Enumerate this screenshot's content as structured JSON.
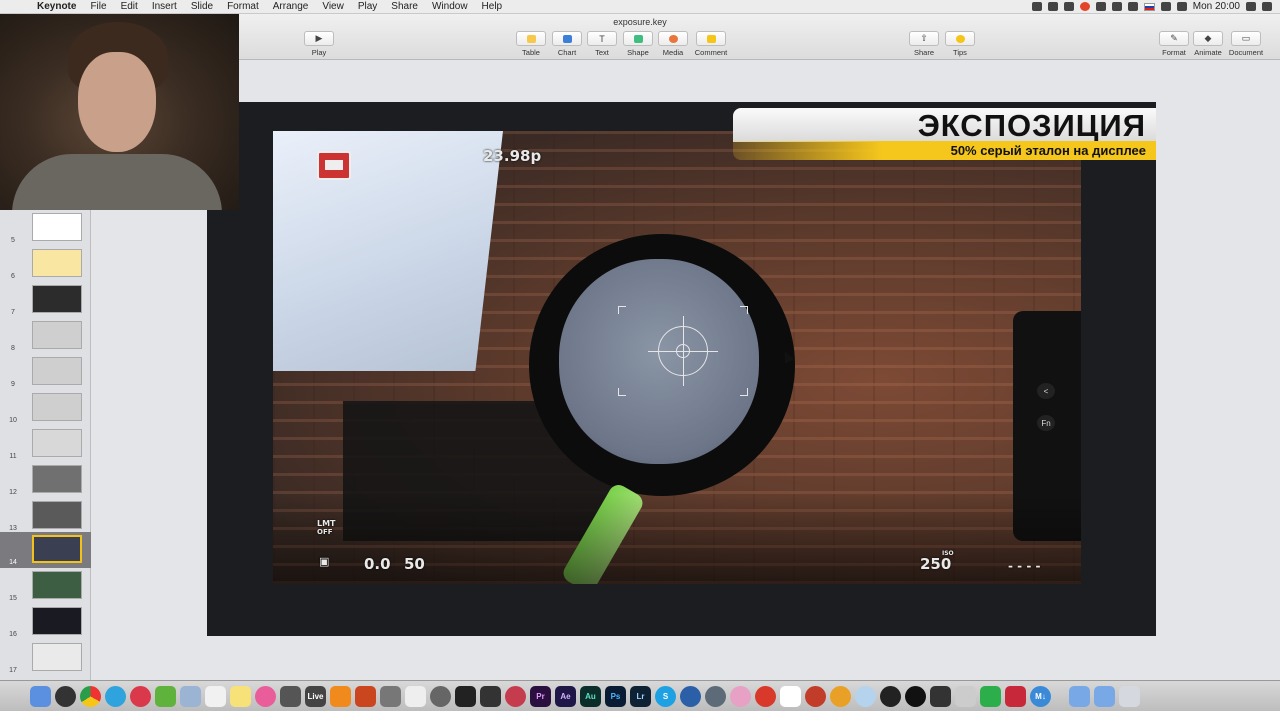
{
  "menubar": {
    "app": "Keynote",
    "items": [
      "File",
      "Edit",
      "Insert",
      "Slide",
      "Format",
      "Arrange",
      "View",
      "Play",
      "Share",
      "Window",
      "Help"
    ],
    "clock": "Mon 20:00"
  },
  "toolbar": {
    "doc_title": "exposure.key",
    "play": "Play",
    "table": "Table",
    "chart": "Chart",
    "text": "Text",
    "shape": "Shape",
    "media": "Media",
    "comment": "Comment",
    "share": "Share",
    "tips": "Tips",
    "format": "Format",
    "animate": "Animate",
    "document": "Document",
    "colors": {
      "table": "#f7c84a",
      "chart": "#3b7fd9",
      "shape": "#3fbf7f",
      "media": "#e8763a",
      "comment": "#f5c518",
      "tips": "#f5c518"
    }
  },
  "sidebar": {
    "slides": [
      "5",
      "6",
      "7",
      "8",
      "9",
      "10",
      "11",
      "12",
      "13",
      "14",
      "15",
      "16",
      "17"
    ],
    "selected": "14"
  },
  "slide": {
    "banner_title": "ЭКСПОЗИЦИЯ",
    "banner_subtitle": "50% серый эталон на дисплее",
    "osd": {
      "fps": "23.98p",
      "lmt": "LMT",
      "off": "OFF",
      "ev": "0.0",
      "fifty": "50",
      "shutter": "250",
      "iso_small": "ISO"
    },
    "camera_buttons": [
      "<",
      "Fn"
    ]
  },
  "dock": {
    "icons": [
      "finder",
      "launchpad",
      "chrome",
      "telegram",
      "lips",
      "utorrent",
      "preview",
      "textedit",
      "notes",
      "itunes",
      "calculator",
      "live",
      "vlc",
      "fire",
      "automator",
      "paw",
      "activity",
      "terminal",
      "mountain",
      "davinci",
      "premiere",
      "aftereffects",
      "audition",
      "photoshop",
      "lightroom",
      "skype",
      "quill",
      "safari",
      "flower",
      "airmail",
      "dictionary",
      "font",
      "sun",
      "one",
      "camera",
      "github",
      "clapper",
      "sketch",
      "evernote",
      "notebook",
      "markdown",
      "appstore",
      "folder",
      "trash"
    ],
    "labels": {
      "live": "Live",
      "premiere": "Pr",
      "aftereffects": "Ae",
      "audition": "Au",
      "photoshop": "Ps",
      "lightroom": "Lr",
      "skype": "S",
      "markdown": "M↓"
    }
  }
}
